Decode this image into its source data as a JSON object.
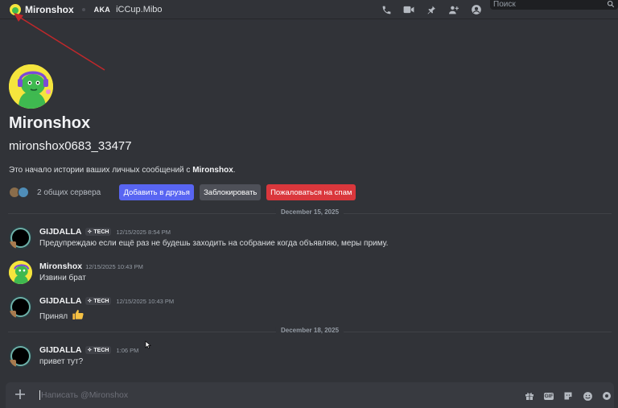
{
  "header": {
    "name": "Mironshox",
    "aka_label": "AKA",
    "alias": "iCCup.Mibo",
    "icons": [
      "voice-call-icon",
      "video-call-icon",
      "pinned-messages-icon",
      "add-friends-to-dm-icon",
      "user-profile-icon"
    ],
    "search_placeholder": "Поиск"
  },
  "profile": {
    "display_name": "Mironshox",
    "username": "mironshox0683_33477",
    "intro_prefix": "Это начало истории ваших личных сообщений с ",
    "intro_name": "Mironshox",
    "intro_suffix": ".",
    "mutual_servers": "2 общих сервера",
    "add_friend": "Добавить в друзья",
    "block": "Заблокировать",
    "report_spam": "Пожаловаться на спам"
  },
  "dividers": [
    "December 15, 2025",
    "December 18, 2025"
  ],
  "messages": [
    {
      "author": "GIJDALLA",
      "tag": "TECH",
      "time": "12/15/2025 8:54 PM",
      "text": "Предупреждаю если ещё раз не будешь заходить на собрание когда объявляю, меры приму."
    },
    {
      "author": "Mironshox",
      "tag": "",
      "time": "12/15/2025 10:43 PM",
      "text": "Извини брат"
    },
    {
      "author": "GIJDALLA",
      "tag": "TECH",
      "time": "12/15/2025 10:43 PM",
      "text": "Принял",
      "emoji": "thumbs-up"
    },
    {
      "author": "GIJDALLA",
      "tag": "TECH",
      "time": "1:06 PM",
      "text": "привет тут?"
    }
  ],
  "composer": {
    "placeholder": "Написать @Mironshox",
    "gif_label": "GIF",
    "tools": [
      "gift-icon",
      "gif-icon",
      "sticker-icon",
      "emoji-icon",
      "apps-icon"
    ]
  },
  "colors": {
    "background": "#313338",
    "add_friend": "#5865f2",
    "block": "#4e5058",
    "report": "#da373c",
    "annotation_arrow": "#c0282b"
  }
}
